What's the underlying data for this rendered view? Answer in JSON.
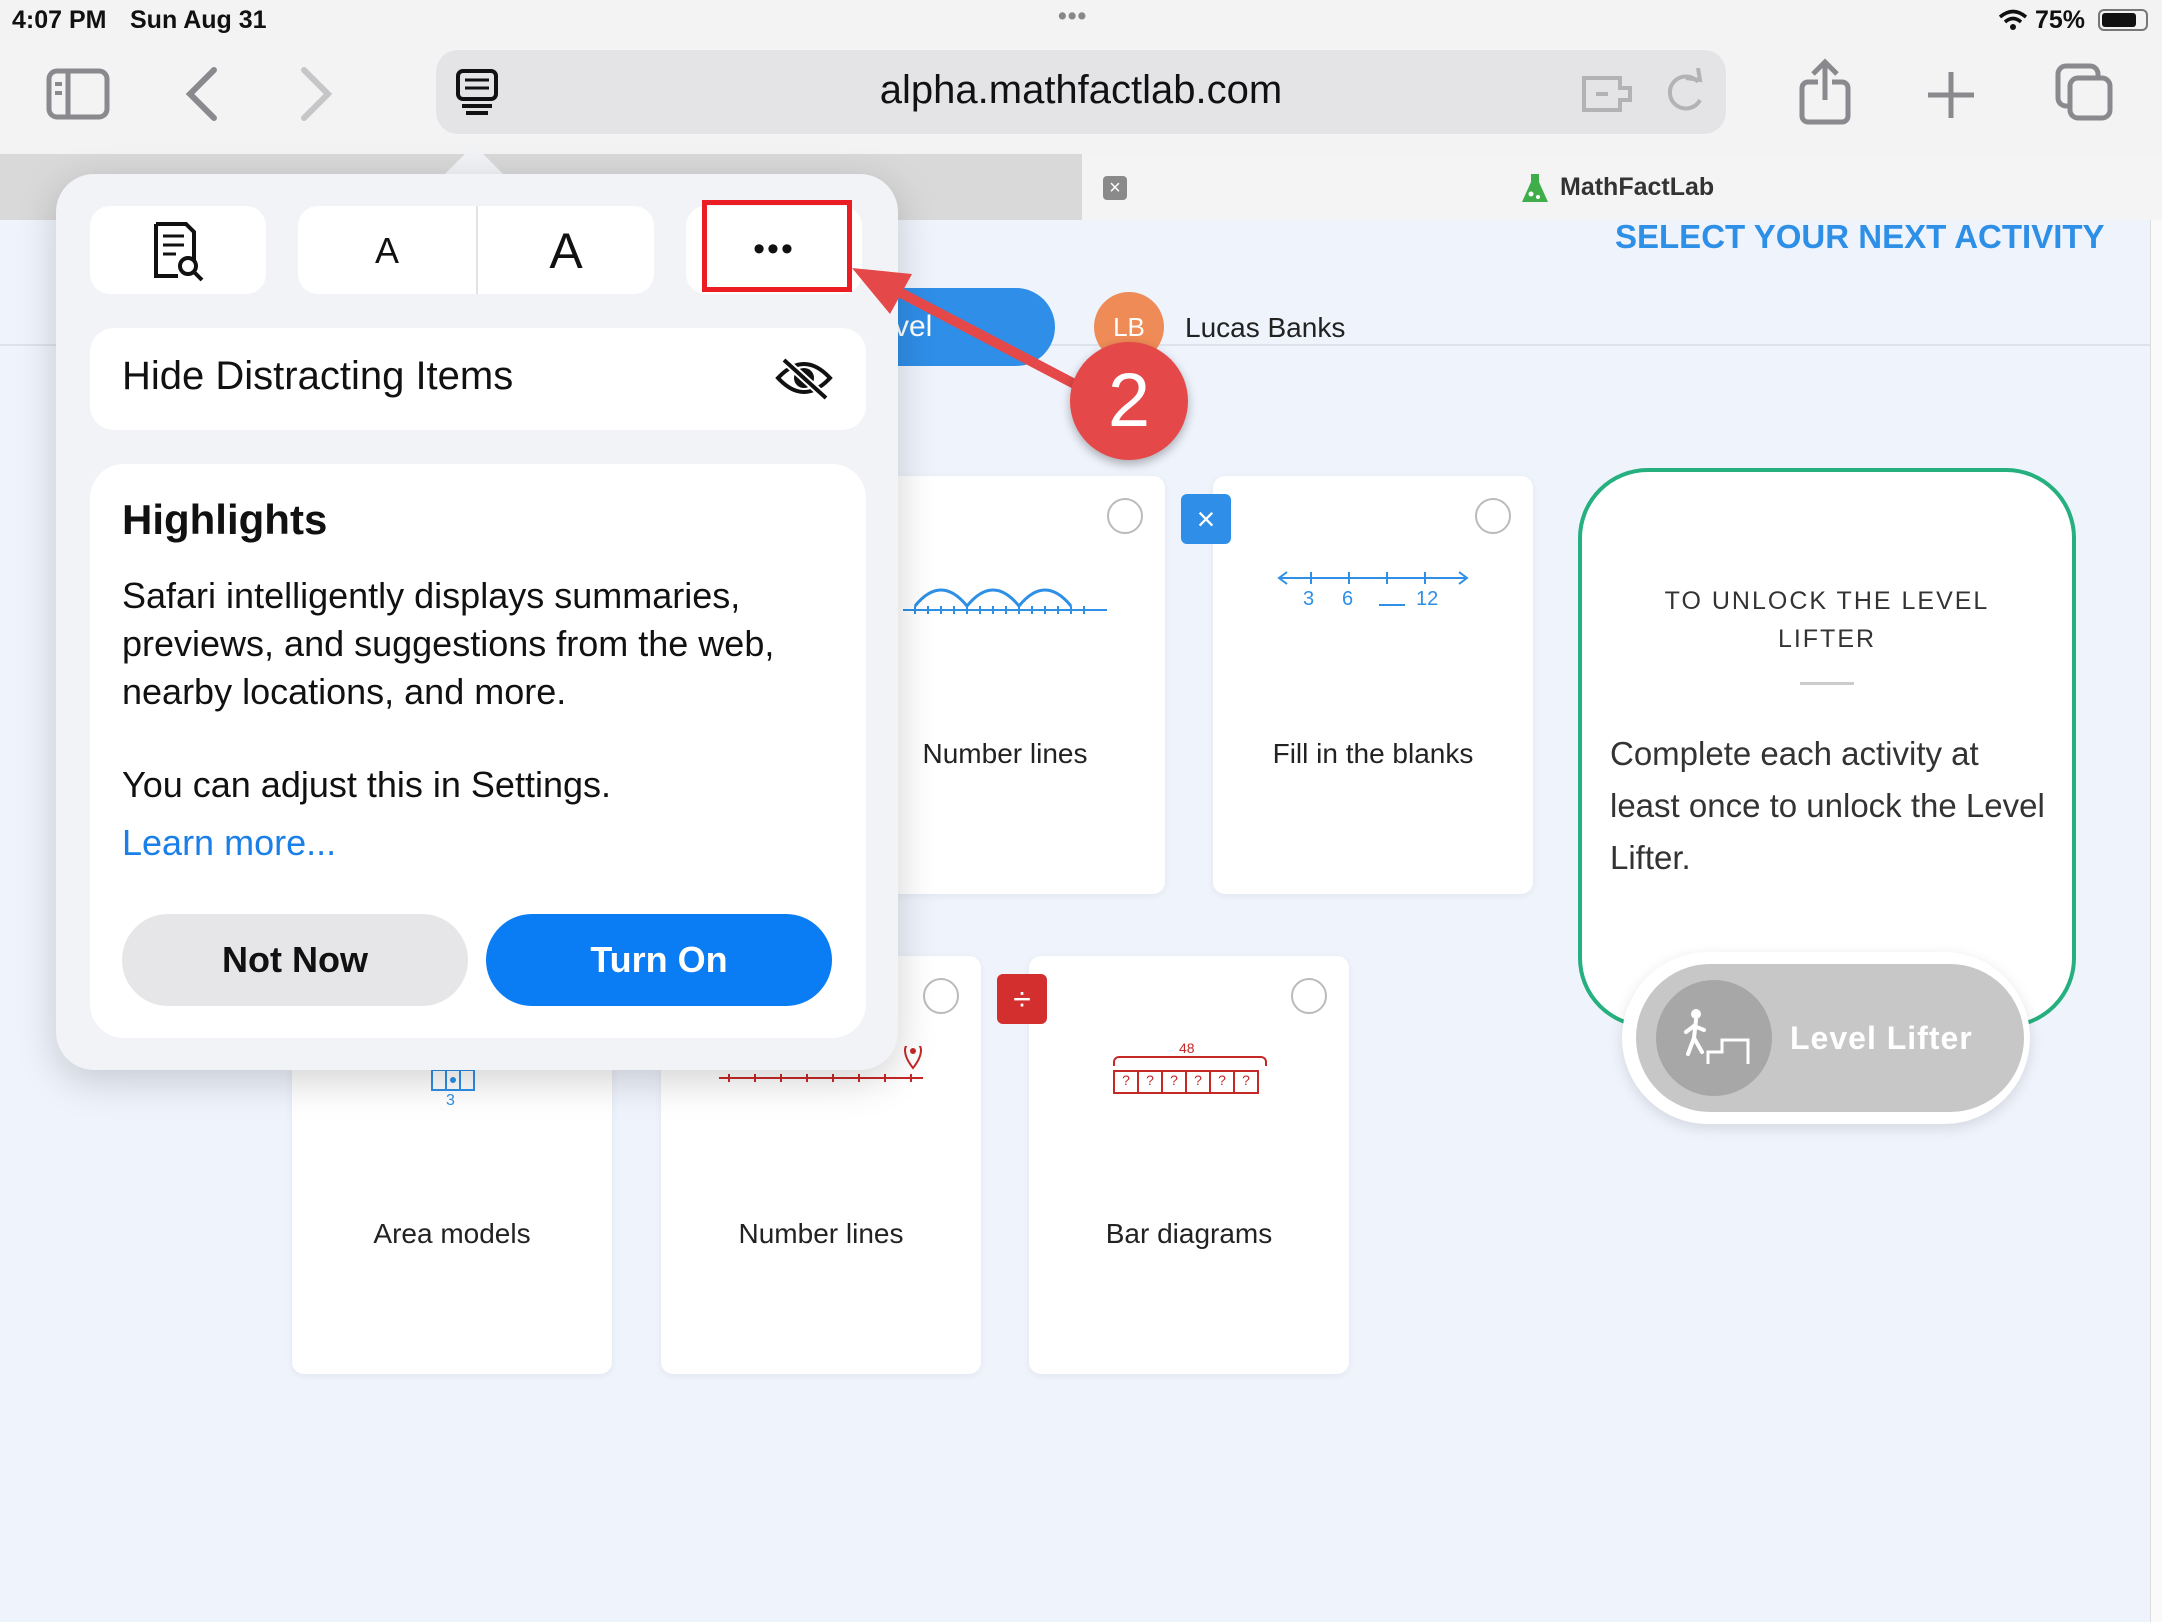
{
  "status_bar": {
    "time": "4:07 PM",
    "date": "Sun Aug 31",
    "dots": "•••",
    "battery": "75%"
  },
  "browser": {
    "url": "alpha.mathfactlab.com",
    "tab_title": "MathFactLab",
    "tab_close": "×"
  },
  "page": {
    "heading": "SELECT YOUR NEXT ACTIVITY",
    "level_button_fragment": "vel",
    "user_initials": "LB",
    "user_name": "Lucas Banks",
    "cards": [
      {
        "label": "Number lines"
      },
      {
        "label": "Fill in the blanks",
        "diagram_numbers": [
          "3",
          "6",
          "12"
        ]
      },
      {
        "label": "Area models",
        "diagram_number": "3"
      },
      {
        "label": "Number lines"
      },
      {
        "label": "Bar diagrams",
        "diagram_total": "48",
        "diagram_cells": [
          "?",
          "?",
          "?",
          "?",
          "?",
          "?"
        ]
      }
    ],
    "badges": {
      "multiply": "×",
      "divide": "÷"
    },
    "lock": {
      "title": "TO UNLOCK THE LEVEL LIFTER",
      "text": "Complete each activity at least once to unlock the Level Lifter.",
      "button_label": "Level Lifter"
    }
  },
  "popover": {
    "font_small": "A",
    "font_large": "A",
    "more": "•••",
    "hide_items": "Hide Distracting Items",
    "highlights_title": "Highlights",
    "highlights_body": "Safari intelligently displays summaries, previews, and suggestions from the web, nearby locations, and more.",
    "highlights_settings": "You can adjust this in Settings.",
    "learn_more": "Learn more...",
    "not_now": "Not Now",
    "turn_on": "Turn On"
  },
  "annotation": {
    "step": "2",
    "highlight_color": "#ec1c24",
    "arrow_color": "#e54848"
  },
  "colors": {
    "accent": "#0a7cf4",
    "heading_blue": "#2d8fe6",
    "lock_border": "#26b07f",
    "badge_blue": "#2f8ee8",
    "badge_red": "#d32f2f"
  }
}
